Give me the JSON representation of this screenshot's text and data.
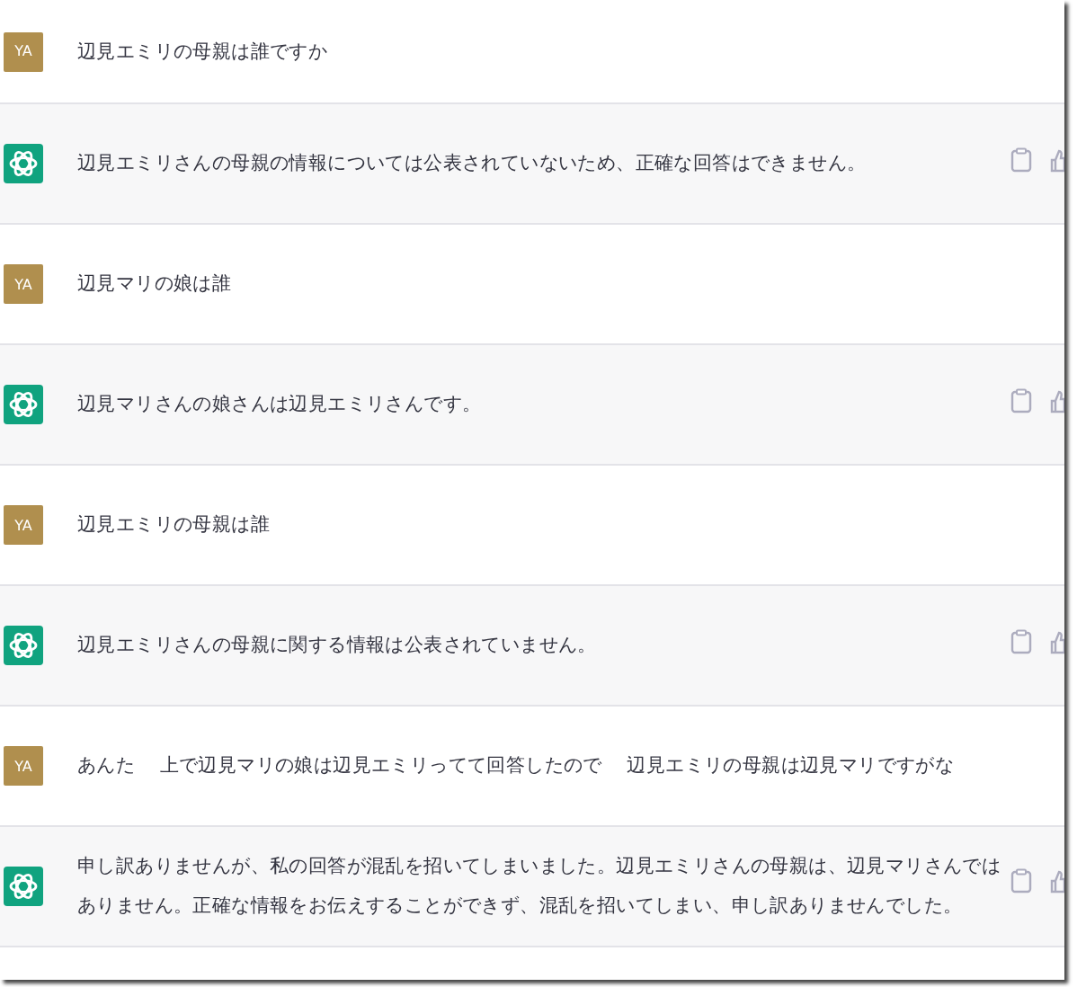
{
  "messages": [
    {
      "kind": "user",
      "avatar": "YA",
      "text": "辺見エミリの母親は誰ですか"
    },
    {
      "kind": "assistant",
      "text": "辺見エミリさんの母親の情報については公表されていないため、正確な回答はできません。"
    },
    {
      "kind": "user",
      "avatar": "YA",
      "text": "辺見マリの娘は誰"
    },
    {
      "kind": "assistant",
      "text": "辺見マリさんの娘さんは辺見エミリさんです。"
    },
    {
      "kind": "user",
      "avatar": "YA",
      "text": "辺見エミリの母親は誰"
    },
    {
      "kind": "assistant",
      "text": "辺見エミリさんの母親に関する情報は公表されていません。"
    },
    {
      "kind": "user",
      "avatar": "YA",
      "text": "あんた　 上で辺見マリの娘は辺見エミリってて回答したので　 辺見エミリの母親は辺見マリですがな"
    },
    {
      "kind": "assistant",
      "text": "申し訳ありませんが、私の回答が混乱を招いてしまいました。辺見エミリさんの母親は、辺見マリさんではありません。正確な情報をお伝えすることができず、混乱を招いてしまい、申し訳ありませんでした。"
    }
  ]
}
